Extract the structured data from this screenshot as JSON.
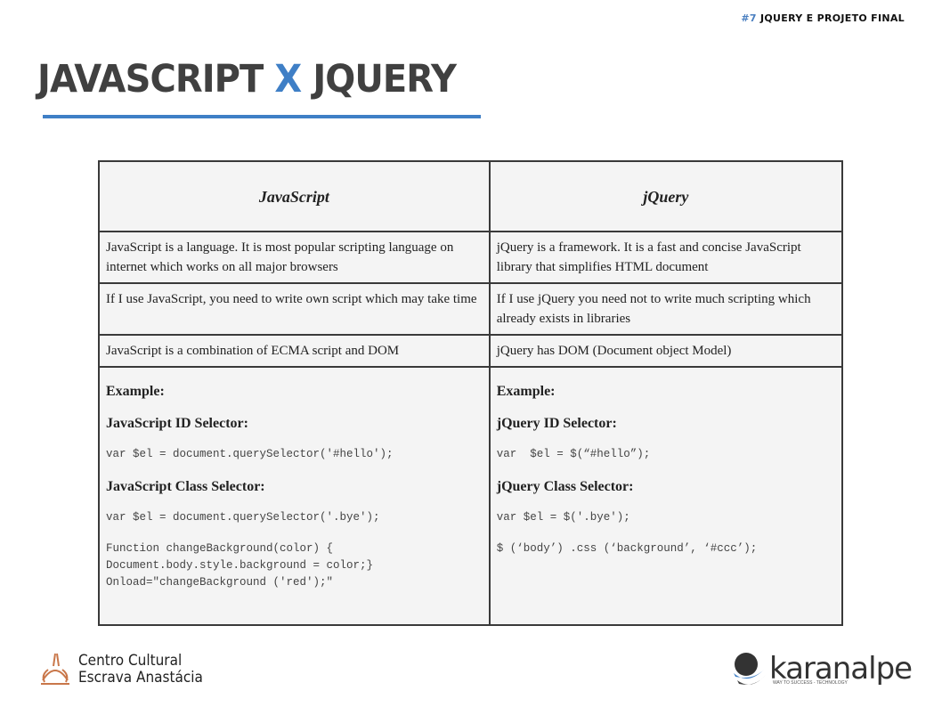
{
  "header": {
    "topic_number": "#7",
    "topic_label": "JQUERY E PROJETO FINAL",
    "title_left": "JAVASCRIPT",
    "title_x": "X",
    "title_right": "JQUERY"
  },
  "table": {
    "headers": [
      "JavaScript",
      "jQuery"
    ],
    "rows": [
      [
        "JavaScript is a language. It is most popular scripting language on internet which works on all major browsers",
        "jQuery is a framework. It is a fast and concise JavaScript library that simplifies HTML document"
      ],
      [
        "If I use JavaScript, you need to write own script which may take time",
        "If I use jQuery you need not to write much scripting which already exists in libraries"
      ],
      [
        "JavaScript is a combination of ECMA script and DOM",
        "jQuery has DOM (Document object Model)"
      ]
    ],
    "example": {
      "js": {
        "heading": "Example:",
        "id_label": "JavaScript ID Selector:",
        "id_code": "var $el = document.querySelector('#hello');",
        "class_label": "JavaScript Class Selector:",
        "class_code": "var $el = document.querySelector('.bye');",
        "extra_code": "Function changeBackground(color) {\nDocument.body.style.background = color;}\nOnload=\"changeBackground ('red');\""
      },
      "jq": {
        "heading": "Example:",
        "id_label": "jQuery ID Selector:",
        "id_code": "var  $el = $(“#hello”);",
        "class_label": "jQuery Class Selector:",
        "class_code": "var $el = $('.bye');",
        "extra_code": "$ (‘body’) .css (‘background’, ‘#ccc’);"
      }
    }
  },
  "footer": {
    "left_logo_line1": "Centro Cultural",
    "left_logo_line2": "Escrava Anastácia",
    "right_logo_name": "karanalpe",
    "right_logo_tagline": "WAY TO SUCCESS - TECHNOLOGY"
  },
  "colors": {
    "accent": "#3f7fc6",
    "title": "#404040"
  }
}
